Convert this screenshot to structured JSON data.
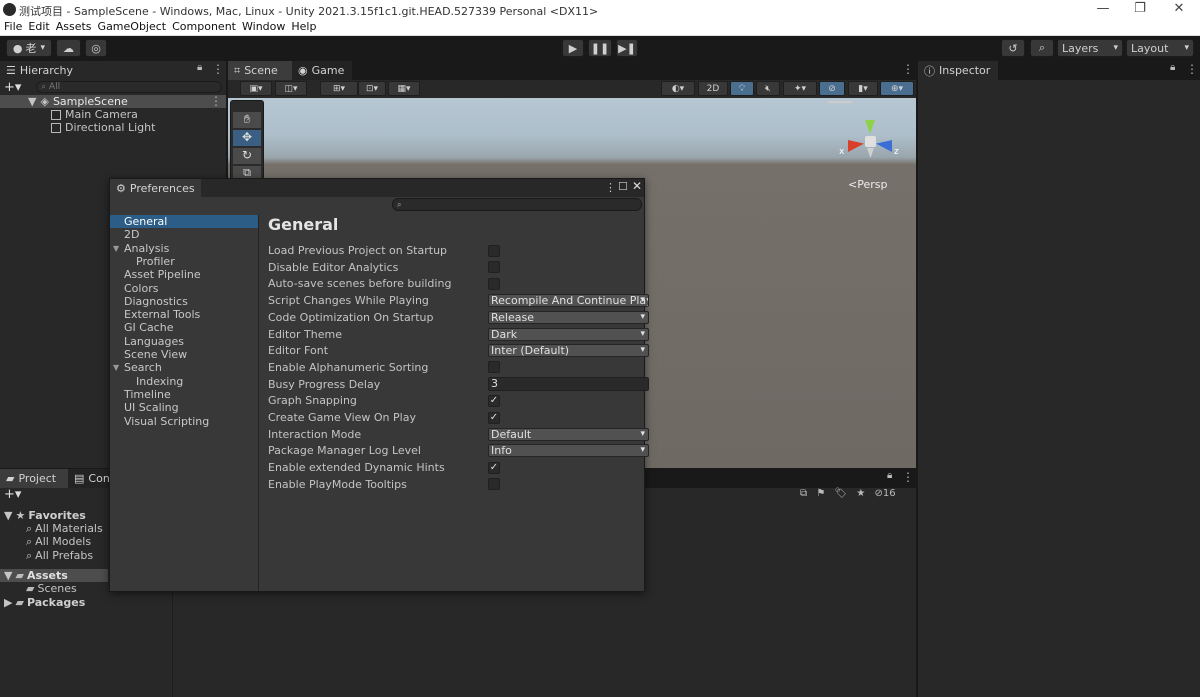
{
  "window": {
    "title": "测试项目 - SampleScene - Windows, Mac, Linux - Unity 2021.3.15f1c1.git.HEAD.527339 Personal <DX11>",
    "controls": [
      "—",
      "❐",
      "✕"
    ]
  },
  "menu": [
    "File",
    "Edit",
    "Assets",
    "GameObject",
    "Component",
    "Window",
    "Help"
  ],
  "toolbar": {
    "account_label": "老",
    "layers_label": "Layers",
    "layout_label": "Layout"
  },
  "hierarchy": {
    "tab": "Hierarchy",
    "search_placeholder": "All",
    "scene": "SampleScene",
    "items": [
      "Main Camera",
      "Directional Light"
    ]
  },
  "scene": {
    "tabs": [
      "Scene",
      "Game"
    ],
    "toggle_2d": "2D",
    "persp_label": "<Persp",
    "gizmo_x": "x",
    "gizmo_z": "z"
  },
  "inspector": {
    "tab": "Inspector"
  },
  "project": {
    "tabs": [
      "Project",
      "Cons"
    ],
    "hidden_count": "16",
    "favorites_label": "Favorites",
    "favorites": [
      "All Materials",
      "All Models",
      "All Prefabs"
    ],
    "assets_label": "Assets",
    "assets_children": [
      "Scenes"
    ],
    "packages_label": "Packages"
  },
  "preferences": {
    "window_title": "Preferences",
    "section_title": "General",
    "nav": [
      {
        "label": "General",
        "indent": 0,
        "active": true
      },
      {
        "label": "2D",
        "indent": 0
      },
      {
        "label": "Analysis",
        "indent": 0,
        "expanded": true
      },
      {
        "label": "Profiler",
        "indent": 1
      },
      {
        "label": "Asset Pipeline",
        "indent": 0
      },
      {
        "label": "Colors",
        "indent": 0
      },
      {
        "label": "Diagnostics",
        "indent": 0
      },
      {
        "label": "External Tools",
        "indent": 0
      },
      {
        "label": "GI Cache",
        "indent": 0
      },
      {
        "label": "Languages",
        "indent": 0
      },
      {
        "label": "Scene View",
        "indent": 0
      },
      {
        "label": "Search",
        "indent": 0,
        "expanded": true
      },
      {
        "label": "Indexing",
        "indent": 1
      },
      {
        "label": "Timeline",
        "indent": 0
      },
      {
        "label": "UI Scaling",
        "indent": 0
      },
      {
        "label": "Visual Scripting",
        "indent": 0
      }
    ],
    "settings": [
      {
        "label": "Load Previous Project on Startup",
        "type": "checkbox",
        "checked": false
      },
      {
        "label": "Disable Editor Analytics",
        "type": "checkbox",
        "checked": false
      },
      {
        "label": "Auto-save scenes before building",
        "type": "checkbox",
        "checked": false
      },
      {
        "label": "Script Changes While Playing",
        "type": "dropdown",
        "value": "Recompile And Continue Playi"
      },
      {
        "label": "Code Optimization On Startup",
        "type": "dropdown",
        "value": "Release"
      },
      {
        "label": "Editor Theme",
        "type": "dropdown",
        "value": "Dark"
      },
      {
        "label": "Editor Font",
        "type": "dropdown",
        "value": "Inter (Default)"
      },
      {
        "label": "Enable Alphanumeric Sorting",
        "type": "checkbox",
        "checked": false
      },
      {
        "label": "Busy Progress Delay",
        "type": "text",
        "value": "3"
      },
      {
        "label": "Graph Snapping",
        "type": "checkbox",
        "checked": true
      },
      {
        "label": "Create Game View On Play",
        "type": "checkbox",
        "checked": true
      },
      {
        "label": "Interaction Mode",
        "type": "dropdown",
        "value": "Default"
      },
      {
        "label": "Package Manager Log Level",
        "type": "dropdown",
        "value": "Info"
      },
      {
        "label": "Enable extended Dynamic Hints",
        "type": "checkbox",
        "checked": true
      },
      {
        "label": "Enable PlayMode Tooltips",
        "type": "checkbox",
        "checked": false
      }
    ]
  }
}
